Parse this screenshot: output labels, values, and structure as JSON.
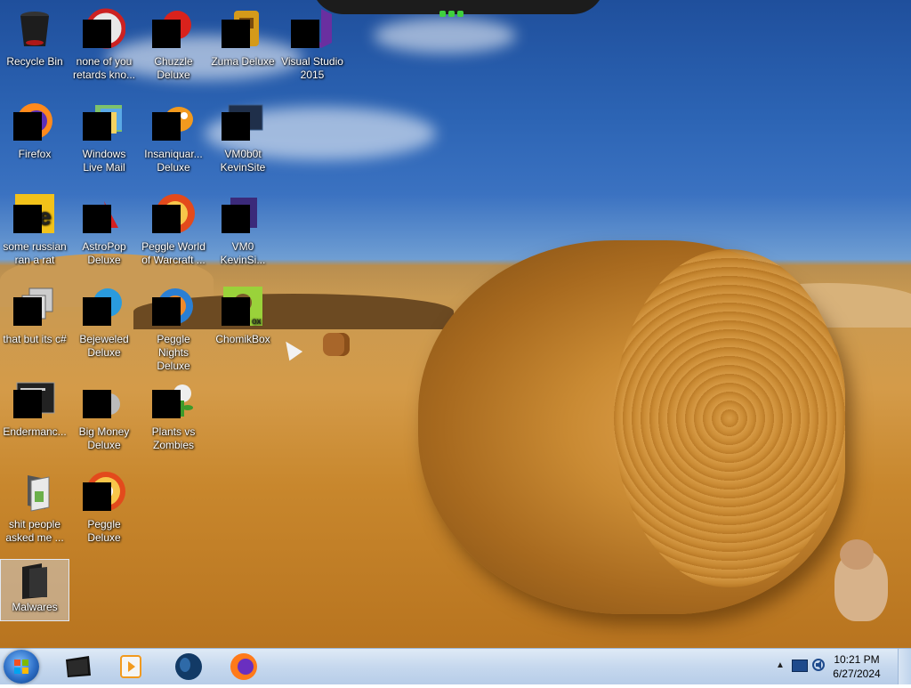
{
  "desktop": {
    "icons": [
      {
        "label": "Recycle Bin",
        "icon": "recycle-bin-icon"
      },
      {
        "label": "none of you retards kno...",
        "icon": "redacted-icon"
      },
      {
        "label": "Chuzzle Deluxe",
        "icon": "chuzzle-icon"
      },
      {
        "label": "Zuma Deluxe",
        "icon": "zuma-icon"
      },
      {
        "label": "Visual Studio 2015",
        "icon": "visual-studio-icon"
      },
      {
        "label": "Firefox",
        "icon": "firefox-icon"
      },
      {
        "label": "Windows Live Mail",
        "icon": "windows-live-mail-icon"
      },
      {
        "label": "Insaniquar... Deluxe",
        "icon": "insaniquarium-icon"
      },
      {
        "label": "VM0b0t KevinSite",
        "icon": "vm-icon"
      },
      {
        "label": "some russian ran a rat",
        "icon": "redacted-icon"
      },
      {
        "label": "AstroPop Deluxe",
        "icon": "astropop-icon"
      },
      {
        "label": "Peggle World of Warcraft ...",
        "icon": "peggle-icon"
      },
      {
        "label": "VM0 KevinSi...",
        "icon": "vm-icon"
      },
      {
        "label": "that but its c#",
        "icon": "redacted-icon"
      },
      {
        "label": "Bejeweled Deluxe",
        "icon": "bejeweled-icon"
      },
      {
        "label": "Peggle Nights Deluxe",
        "icon": "peggle-nights-icon"
      },
      {
        "label": "ChomikBox",
        "icon": "chomikbox-icon"
      },
      {
        "label": "Endermanc...",
        "icon": "terminal-icon"
      },
      {
        "label": "Big Money Deluxe",
        "icon": "big-money-icon"
      },
      {
        "label": "Plants vs Zombies",
        "icon": "plants-vs-zombies-icon"
      },
      {
        "label": "shit people asked me ...",
        "icon": "folder-icon"
      },
      {
        "label": "Peggle Deluxe",
        "icon": "peggle-icon"
      },
      {
        "label": "Malwares",
        "icon": "folder-icon"
      }
    ]
  },
  "taskbar": {
    "start_icon": "windows-start-orb-icon",
    "pinned": [
      "command-prompt-icon",
      "media-player-icon",
      "globe-icon",
      "firefox-icon"
    ],
    "tray_icons": [
      "show-hidden-icons-chevron-icon",
      "network-icon",
      "volume-icon"
    ],
    "clock": {
      "time": "10:21 PM",
      "date": "6/27/2024"
    }
  },
  "colors": {
    "taskbar": "#c6d8ee",
    "sky": "#2c64b4",
    "field": "#d49b49"
  }
}
